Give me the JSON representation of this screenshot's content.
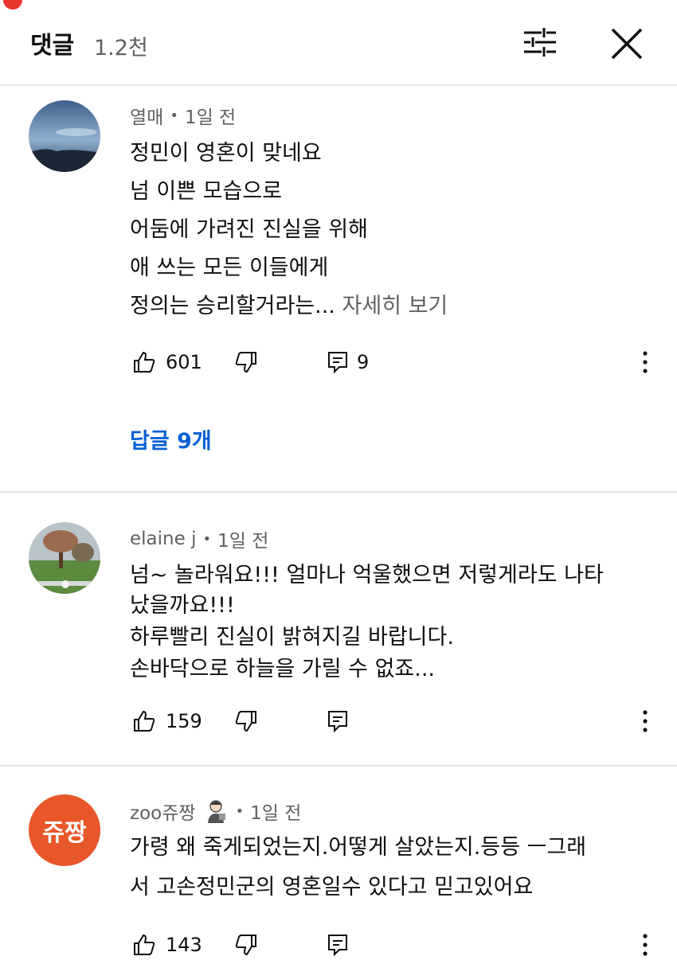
{
  "header": {
    "title": "댓글",
    "count": "1.2천"
  },
  "comments": [
    {
      "author": "열매",
      "time": "1일 전",
      "lines": [
        "정민이 영혼이 맞네요",
        "넘 이쁜 모습으로",
        "어둠에 가려진 진실을 위해",
        "애 쓰는 모든 이들에게"
      ],
      "last_line": "정의는 승리할거라는...",
      "more_label": "자세히 보기",
      "likes": "601",
      "reply_count": "9",
      "replies_link": "답글 9개"
    },
    {
      "author": "elaine j",
      "time": "1일 전",
      "lines": [
        "넘~ 놀라워요!!! 얼마나 억울했으면 저렇게라도 나타",
        "났을까요!!!",
        "하루빨리 진실이 밝혀지길 바랍니다.",
        "손바닥으로 하늘을 가릴 수 없죠..."
      ],
      "likes": "159"
    },
    {
      "author": "zoo쥬짱",
      "time": "1일 전",
      "avatar_text": "쥬짱",
      "avatar_color": "#e8572a",
      "lines": [
        "가령 왜 죽게되었는지.어떻게 살았는지.등등 ㅡ그래",
        "서 고손정민군의 영혼일수 있다고 믿고있어요"
      ],
      "likes": "143"
    }
  ],
  "colors": {
    "link_blue": "#065fd4",
    "secondary_text": "#606060",
    "notification_red": "#e8342b"
  }
}
